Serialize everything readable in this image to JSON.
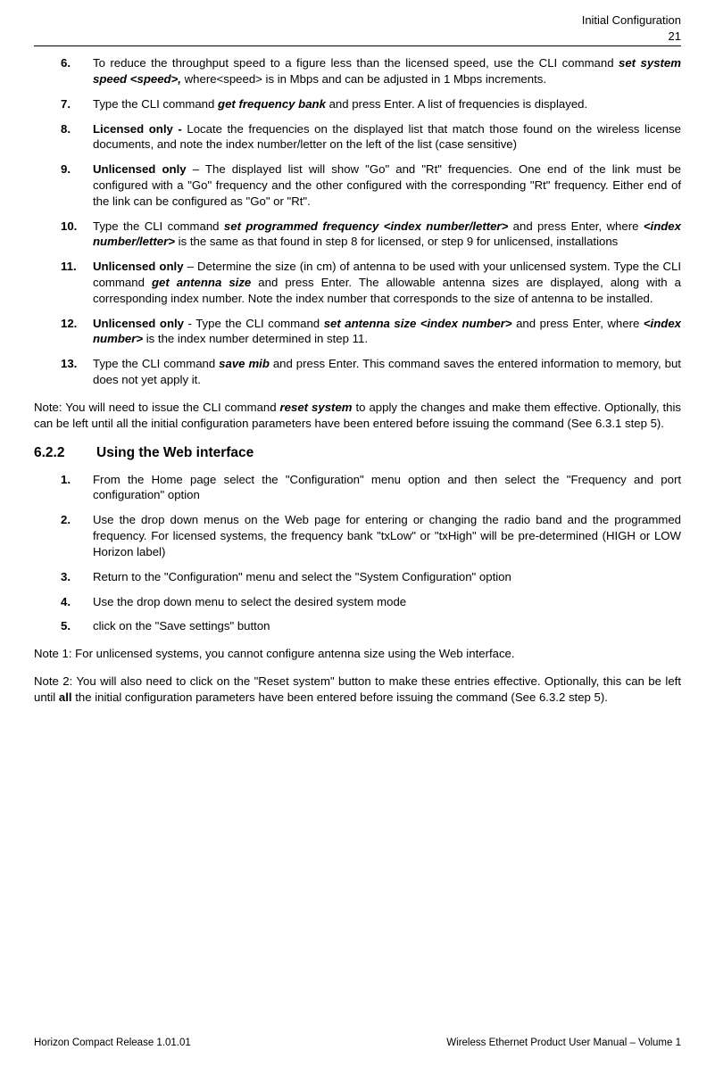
{
  "header": {
    "title": "Initial Configuration",
    "page": "21"
  },
  "listA": {
    "n6": "6.",
    "i6a": "To reduce the throughput speed to a figure less than the licensed speed, use the CLI command ",
    "i6b": "set system speed <speed>,",
    "i6c": " where<speed> is in Mbps and can be adjusted in 1 Mbps increments.",
    "n7": "7.",
    "i7a": "Type the CLI command ",
    "i7b": "get frequency bank",
    "i7c": " and press Enter. A list of frequencies is displayed.",
    "n8": "8.",
    "i8a": "Licensed only - ",
    "i8b": "Locate the frequencies on the displayed list that match those found on the wireless license documents, and note the index number/letter  on the left of the list (case sensitive)",
    "n9": "9.",
    "i9a": "Unlicensed only",
    "i9b": " – The displayed list will show \"Go\" and \"Rt\" frequencies. One end of the link  must be configured with a \"Go\" frequency and the other configured with the corresponding \"Rt\" frequency. Either end of the link can be configured as \"Go\" or \"Rt\".",
    "n10": "10.",
    "i10a": "Type the CLI command ",
    "i10b": "set programmed frequency <index number/letter>",
    "i10c": " and press Enter, where ",
    "i10d": "<index number/letter>",
    "i10e": " is the same as that found in step 8 for licensed, or step 9 for unlicensed, installations",
    "n11": "11.",
    "i11a": "Unlicensed only",
    "i11b": " – Determine the size (in cm) of antenna to be used with your unlicensed system. Type the CLI command  ",
    "i11c": "get antenna size",
    "i11d": " and press Enter. The allowable antenna sizes are displayed, along with a corresponding index number. Note the index number that corresponds to the size of antenna to be installed.",
    "n12": "12.",
    "i12a": "Unlicensed only",
    "i12b": " - Type the CLI command ",
    "i12c": "set antenna size <index number>",
    "i12d": " and press Enter, where ",
    "i12e": "<index number>",
    "i12f": "  is the index number determined in step 11.",
    "n13": "13.",
    "i13a": "Type the CLI command  ",
    "i13b": "save mib",
    "i13c": " and press Enter. This command saves the entered information to memory, but does not yet apply it."
  },
  "noteA": {
    "a": "Note: You will need to issue the CLI command ",
    "b": "reset system",
    "c": " to  apply the changes and make them effective. Optionally, this can be left until all the initial configuration parameters have been entered before issuing the command (See 6.3.1 step 5)."
  },
  "section": {
    "num": "6.2.2",
    "title": "Using the Web interface"
  },
  "listB": {
    "n1": "1.",
    "i1": "From the Home page select the \"Configuration\" menu option and then select the \"Frequency and port configuration\" option",
    "n2": "2.",
    "i2": "Use the drop down menus on the Web page for entering or changing the radio band and the programmed frequency. For licensed systems, the frequency bank \"txLow\" or \"txHigh\" will be pre-determined (HIGH or LOW Horizon label)",
    "n3": "3.",
    "i3": "Return to the \"Configuration\" menu and select the \"System Configuration\" option",
    "n4": "4.",
    "i4": "Use the drop down menu to select the desired system mode",
    "n5": "5.",
    "i5": "click on the \"Save settings\" button"
  },
  "note1": "Note 1: For unlicensed systems, you cannot configure antenna size using the Web interface.",
  "note2": {
    "a": "Note 2: You will  also need to click on the \"Reset system\" button to make these entries effective. Optionally, this can be left until ",
    "b": "all",
    "c": " the initial configuration parameters have been entered before issuing the command (See 6.3.2 step 5)."
  },
  "footer": {
    "left": "Horizon Compact Release 1.01.01",
    "right": "Wireless Ethernet Product User Manual – Volume 1"
  }
}
